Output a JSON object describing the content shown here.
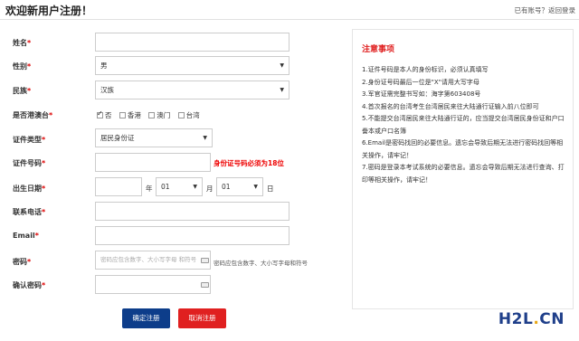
{
  "header": {
    "title": "欢迎新用户注册！",
    "have_account": "已有账号？",
    "back_login": "返回登录"
  },
  "form": {
    "name": {
      "label": "姓名",
      "star": "*",
      "value": ""
    },
    "gender": {
      "label": "性别",
      "star": "*",
      "value": "男"
    },
    "ethnicity": {
      "label": "民族",
      "star": "*",
      "value": "汉族"
    },
    "region": {
      "label": "是否港澳台",
      "star": "*",
      "options": [
        {
          "label": "否",
          "checked": true
        },
        {
          "label": "香港",
          "checked": false
        },
        {
          "label": "澳门",
          "checked": false
        },
        {
          "label": "台湾",
          "checked": false
        }
      ]
    },
    "id_type": {
      "label": "证件类型",
      "star": "*",
      "value": "居民身份证"
    },
    "id_number": {
      "label": "证件号码",
      "star": "*",
      "value": "",
      "error": "身份证号码必须为18位"
    },
    "birth": {
      "label": "出生日期",
      "star": "*",
      "year_value": "",
      "year_unit": "年",
      "month_value": "01",
      "month_unit": "月",
      "day_value": "01",
      "day_unit": "日"
    },
    "phone": {
      "label": "联系电话",
      "star": "*",
      "value": ""
    },
    "email": {
      "label": "Email",
      "star": "*",
      "value": ""
    },
    "password": {
      "label": "密码",
      "star": "*",
      "placeholder": "密码应包含数字、大小写字母 和符号",
      "hint": "密码应包含数字、大小写字母和符号"
    },
    "confirm_password": {
      "label": "确认密码",
      "star": "*",
      "value": ""
    },
    "submit_label": "确定注册",
    "cancel_label": "取消注册"
  },
  "notes": {
    "title": "注意事项",
    "items": [
      "1.证件号码是本人的身份标识，必须认真填写",
      "2.身份证号码最后一位是\"X\"请用大写字母",
      "3.军官证需完整书写如：海字第603408号",
      "4.首次报名的台湾考生台湾居民来往大陆通行证输入前八位即可",
      "5.不能提交台湾居民来往大陆通行证的，应当提交台湾居民身份证和户口誊本或户口名簿",
      "6.Email是密码找回的必要信息。遗忘会导致后期无法进行密码找回等相关操作，请牢记！",
      "7.密码是登录本考试系统的必要信息。遗忘会导致后期无法进行查询、打印等相关操作，请牢记！"
    ]
  },
  "watermark": {
    "part1": "H2L",
    "part2": ".",
    "part3": "CN"
  },
  "colors": {
    "accent_red": "#e02020",
    "primary_blue": "#0d3d8a",
    "error_red": "#e00"
  }
}
